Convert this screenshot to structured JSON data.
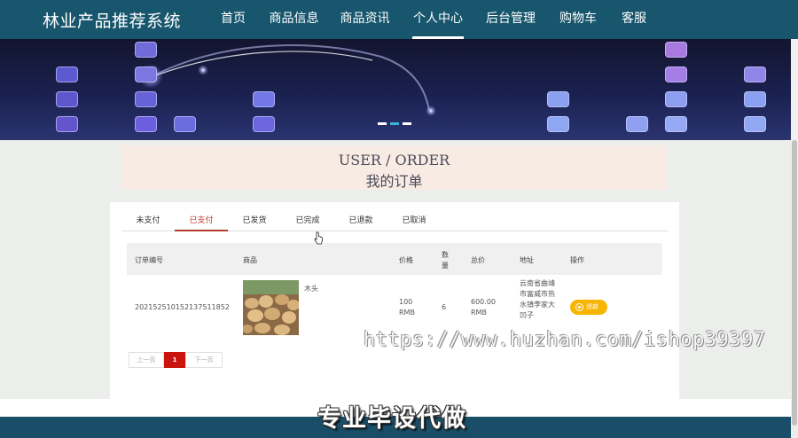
{
  "brand": "林业产品推荐系统",
  "nav": [
    {
      "label": "首页",
      "active": false
    },
    {
      "label": "商品信息",
      "active": false
    },
    {
      "label": "商品资讯",
      "active": false
    },
    {
      "label": "个人中心",
      "active": true
    },
    {
      "label": "后台管理",
      "active": false
    },
    {
      "label": "购物车",
      "active": false
    },
    {
      "label": "客服",
      "active": false
    }
  ],
  "banner": {
    "slide_count": 3,
    "active_slide": 2
  },
  "page_title": {
    "en": "USER / ORDER",
    "cn": "我的订单"
  },
  "tabs": [
    {
      "label": "未支付",
      "active": false
    },
    {
      "label": "已支付",
      "active": true
    },
    {
      "label": "已发货",
      "active": false
    },
    {
      "label": "已完成",
      "active": false
    },
    {
      "label": "已退款",
      "active": false
    },
    {
      "label": "已取消",
      "active": false
    }
  ],
  "table": {
    "headers": {
      "order_no": "订单编号",
      "product": "商品",
      "price": "价格",
      "qty": "数量",
      "total": "总价",
      "address": "地址",
      "action": "操作"
    },
    "rows": [
      {
        "order_no": "202152510152137511852",
        "product_name": "木头",
        "price": "100 RMB",
        "qty": "6",
        "total": "600.00 RMB",
        "address": "云南省曲靖市富威市热水镇李家大凹子",
        "action_label": "退款"
      }
    ]
  },
  "pager": {
    "prev": "上一页",
    "current": "1",
    "next": "下一页"
  },
  "watermark": "https://www.huzhan.com/ishop39397",
  "caption": "专业毕设代做",
  "colors": {
    "nav_bg": "#17566d",
    "active_tab": "#c0392b",
    "pager_current": "#c9150e",
    "refund_btn": "#f6b500"
  }
}
